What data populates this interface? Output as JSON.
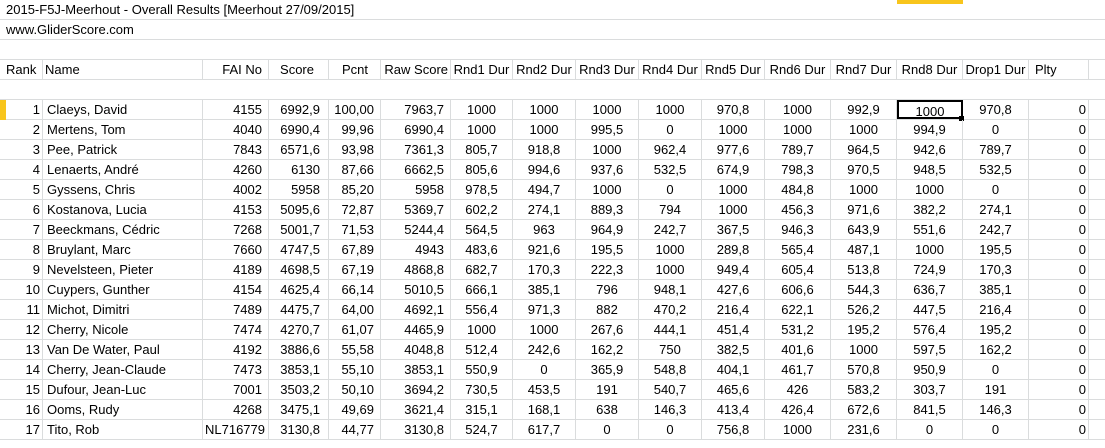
{
  "title": "2015-F5J-Meerhout - Overall Results  [Meerhout 27/09/2015]",
  "website": "www.GliderScore.com",
  "headers": [
    "Rank",
    "Name",
    "FAI No",
    "Score",
    "Pcnt",
    "Raw Score",
    "Rnd1 Dur",
    "Rnd2 Dur",
    "Rnd3 Dur",
    "Rnd4 Dur",
    "Rnd5 Dur",
    "Rnd6 Dur",
    "Rnd7 Dur",
    "Rnd8 Dur",
    "Drop1 Dur",
    "Plty"
  ],
  "rows": [
    [
      "1",
      "Claeys, David",
      "4155",
      "6992,9",
      "100,00",
      "7963,7",
      "1000",
      "1000",
      "1000",
      "1000",
      "970,8",
      "1000",
      "992,9",
      "1000",
      "970,8",
      "0"
    ],
    [
      "2",
      "Mertens, Tom",
      "4040",
      "6990,4",
      "99,96",
      "6990,4",
      "1000",
      "1000",
      "995,5",
      "0",
      "1000",
      "1000",
      "1000",
      "994,9",
      "0",
      "0"
    ],
    [
      "3",
      "Pee, Patrick",
      "7843",
      "6571,6",
      "93,98",
      "7361,3",
      "805,7",
      "918,8",
      "1000",
      "962,4",
      "977,6",
      "789,7",
      "964,5",
      "942,6",
      "789,7",
      "0"
    ],
    [
      "4",
      "Lenaerts, André",
      "4260",
      "6130",
      "87,66",
      "6662,5",
      "805,6",
      "994,6",
      "937,6",
      "532,5",
      "674,9",
      "798,3",
      "970,5",
      "948,5",
      "532,5",
      "0"
    ],
    [
      "5",
      "Gyssens, Chris",
      "4002",
      "5958",
      "85,20",
      "5958",
      "978,5",
      "494,7",
      "1000",
      "0",
      "1000",
      "484,8",
      "1000",
      "1000",
      "0",
      "0"
    ],
    [
      "6",
      "Kostanova, Lucia",
      "4153",
      "5095,6",
      "72,87",
      "5369,7",
      "602,2",
      "274,1",
      "889,3",
      "794",
      "1000",
      "456,3",
      "971,6",
      "382,2",
      "274,1",
      "0"
    ],
    [
      "7",
      "Beeckmans, Cédric",
      "7268",
      "5001,7",
      "71,53",
      "5244,4",
      "564,5",
      "963",
      "964,9",
      "242,7",
      "367,5",
      "946,3",
      "643,9",
      "551,6",
      "242,7",
      "0"
    ],
    [
      "8",
      "Bruylant, Marc",
      "7660",
      "4747,5",
      "67,89",
      "4943",
      "483,6",
      "921,6",
      "195,5",
      "1000",
      "289,8",
      "565,4",
      "487,1",
      "1000",
      "195,5",
      "0"
    ],
    [
      "9",
      "Nevelsteen, Pieter",
      "4189",
      "4698,5",
      "67,19",
      "4868,8",
      "682,7",
      "170,3",
      "222,3",
      "1000",
      "949,4",
      "605,4",
      "513,8",
      "724,9",
      "170,3",
      "0"
    ],
    [
      "10",
      "Cuypers, Gunther",
      "4154",
      "4625,4",
      "66,14",
      "5010,5",
      "666,1",
      "385,1",
      "796",
      "948,1",
      "427,6",
      "606,6",
      "544,3",
      "636,7",
      "385,1",
      "0"
    ],
    [
      "11",
      "Michot, Dimitri",
      "7489",
      "4475,7",
      "64,00",
      "4692,1",
      "556,4",
      "971,3",
      "882",
      "470,2",
      "216,4",
      "622,1",
      "526,2",
      "447,5",
      "216,4",
      "0"
    ],
    [
      "12",
      "Cherry, Nicole",
      "7474",
      "4270,7",
      "61,07",
      "4465,9",
      "1000",
      "1000",
      "267,6",
      "444,1",
      "451,4",
      "531,2",
      "195,2",
      "576,4",
      "195,2",
      "0"
    ],
    [
      "13",
      "Van De Water, Paul",
      "4192",
      "3886,6",
      "55,58",
      "4048,8",
      "512,4",
      "242,6",
      "162,2",
      "750",
      "382,5",
      "401,6",
      "1000",
      "597,5",
      "162,2",
      "0"
    ],
    [
      "14",
      "Cherry, Jean-Claude",
      "7473",
      "3853,1",
      "55,10",
      "3853,1",
      "550,9",
      "0",
      "365,9",
      "548,8",
      "404,1",
      "461,7",
      "570,8",
      "950,9",
      "0",
      "0"
    ],
    [
      "15",
      "Dufour, Jean-Luc",
      "7001",
      "3503,2",
      "50,10",
      "3694,2",
      "730,5",
      "453,5",
      "191",
      "540,7",
      "465,6",
      "426",
      "583,2",
      "303,7",
      "191",
      "0"
    ],
    [
      "16",
      "Ooms, Rudy",
      "4268",
      "3475,1",
      "49,69",
      "3621,4",
      "315,1",
      "168,1",
      "638",
      "146,3",
      "413,4",
      "426,4",
      "672,6",
      "841,5",
      "146,3",
      "0"
    ],
    [
      "17",
      "Tito, Rob",
      "NL716779",
      "3130,8",
      "44,77",
      "3130,8",
      "524,7",
      "617,7",
      "0",
      "0",
      "756,8",
      "1000",
      "231,6",
      "0",
      "0",
      "0"
    ]
  ]
}
